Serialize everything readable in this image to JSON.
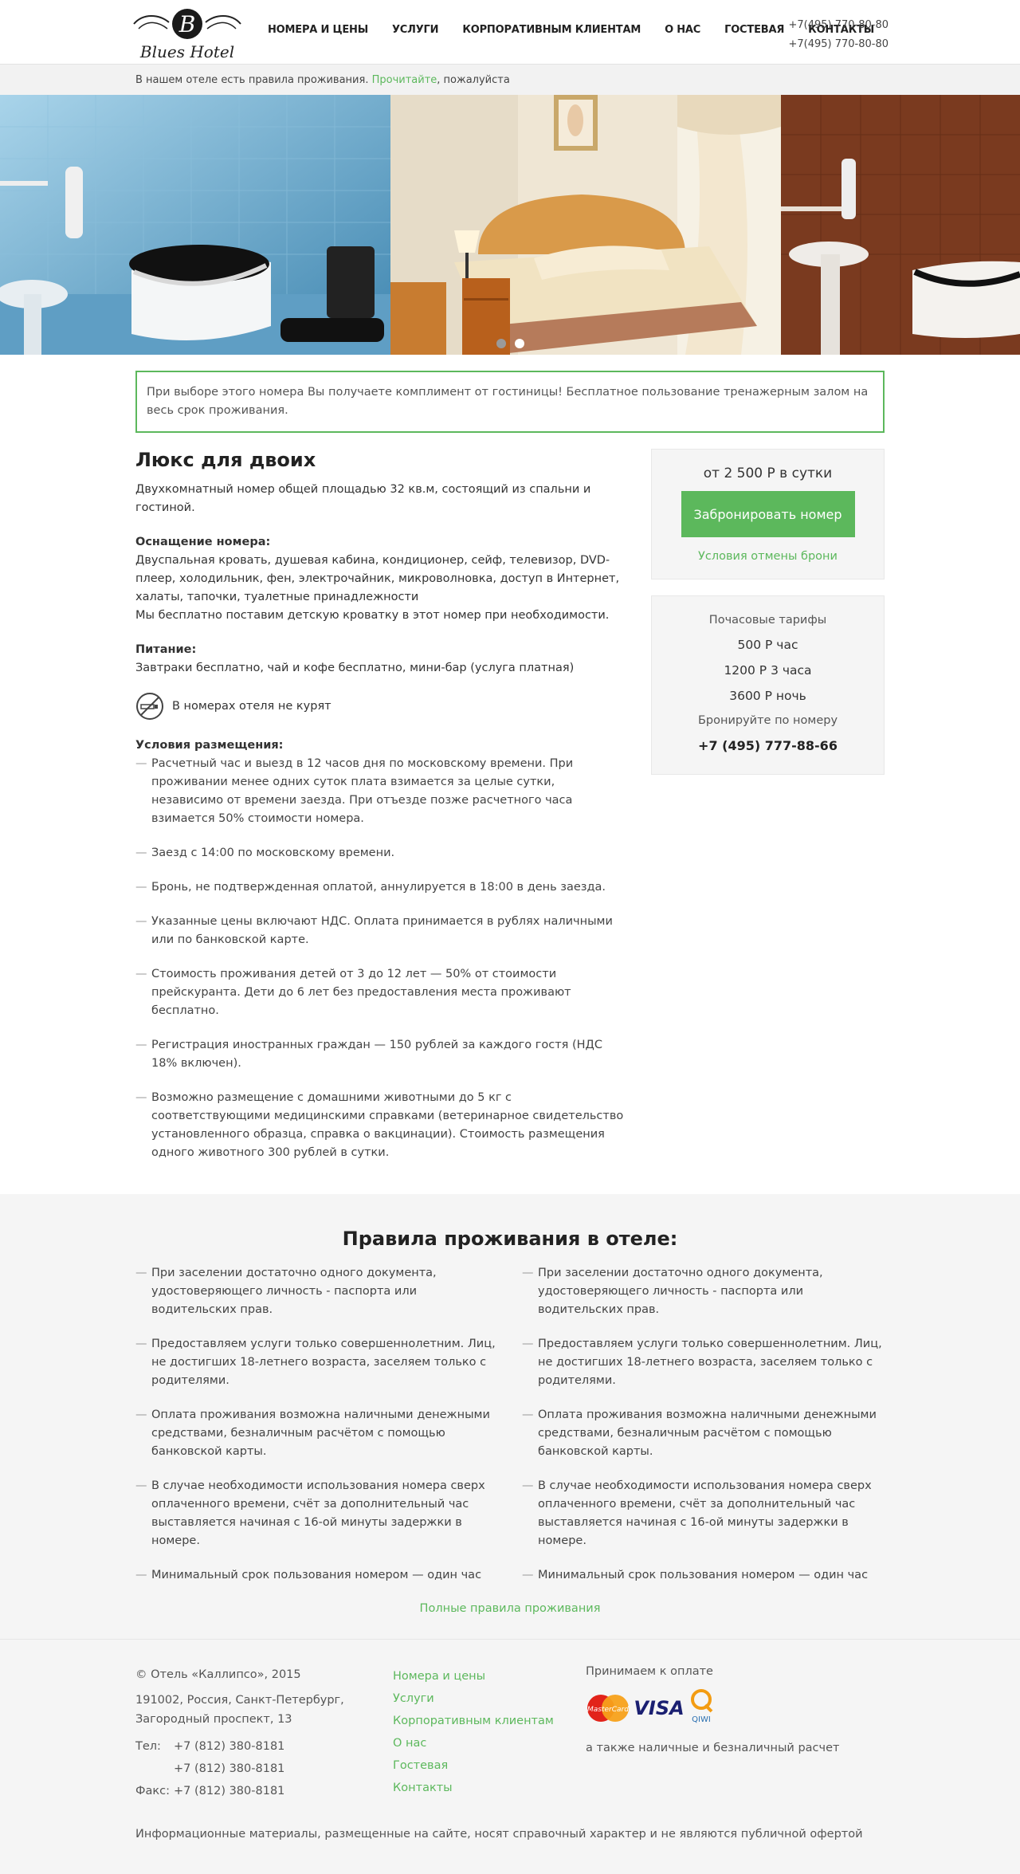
{
  "header": {
    "logo_text": "Blues Hotel",
    "nav": [
      "НОМЕРА И ЦЕНЫ",
      "УСЛУГИ",
      "КОРПОРАТИВНЫМ КЛИЕНТАМ",
      "О НАС",
      "ГОСТЕВАЯ",
      "КОНТАКТЫ"
    ],
    "phone_1": "+7(495) 770-80-80",
    "phone_2": "+7(495) 770-80-80"
  },
  "notice": {
    "text_before": "В нашем отеле есть правила проживания. ",
    "link": "Прочитайте",
    "text_after": ", пожалуйста"
  },
  "slider": {
    "slides": 3,
    "dots": 2,
    "active_dot": 2
  },
  "promo": "При выборе этого номера Вы получаете комплимент от гостиницы! Бесплатное пользование тренажерным залом на весь срок проживания.",
  "room": {
    "title": "Люкс для двоих",
    "lead": "Двухкомнатный номер общей площадью 32 кв.м, состоящий из спальни и гостиной.",
    "equipment_title": "Оснащение номера:",
    "equipment_text": "Двуспальная кровать, душевая кабина, кондиционер, сейф, телевизор, DVD-плеер, холодильник, фен, электрочайник, микроволновка, доступ в Интернет, халаты, тапочки, туалетные принадлежности",
    "equipment_note": "Мы бесплатно поставим детскую кроватку в этот номер при необходимости.",
    "food_title": "Питание:",
    "food_text": "Завтраки бесплатно, чай и кофе бесплатно, мини-бар (услуга платная)",
    "no_smoking": "В номерах отеля не курят",
    "conditions_title": "Условия размещения:",
    "conditions": [
      "Расчетный час и выезд в 12 часов дня по московскому времени. При проживании менее одних суток плата взимается за целые сутки, независимо от времени заезда. При отъезде позже расчетного часа взимается 50% стоимости номера.",
      "Заезд с 14:00 по московскому времени.",
      "Бронь, не подтвержденная оплатой, аннулируется в 18:00 в день заезда.",
      "Указанные цены включают НДС. Оплата принимается в рублях наличными или по банковской карте.",
      "Стоимость проживания детей от 3 до 12 лет — 50% от стоимости прейскуранта. Дети до 6 лет без предоставления места проживают бесплатно.",
      "Регистрация иностранных граждан — 150 рублей за каждого гостя (НДС 18% включен).",
      "Возможно размещение с домашними животными до 5 кг с соответствующими медицинскими справками (ветеринарное свидетельство установленного образца, справка о вакцинации). Стоимость размещения одного животного 300 рублей в сутки."
    ]
  },
  "booking": {
    "price": "от 2 500 Р в сутки",
    "button": "Забронировать номер",
    "cancel_link": "Условия отмены брони"
  },
  "hourly": {
    "title": "Почасовые тарифы",
    "rates": [
      "500 Р час",
      "1200 Р 3 часа",
      "3600 Р ночь"
    ],
    "book_by": "Бронируйте по номеру",
    "phone": "+7 (495) 777-88-66"
  },
  "rules": {
    "title": "Правила проживания в отеле:",
    "left": [
      "При заселении достаточно одного документа, удостоверяющего личность - паспорта или водительских прав.",
      "Предоставляем услуги только совершеннолетним. Лиц, не достигших 18-летнего возраста, заселяем только с родителями.",
      "Оплата проживания возможна наличными денежными средствами, безналичным расчётом с помощью банковской карты.",
      "В случае необходимости использования номера сверх оплаченного времени, счёт за дополнительный час выставляется начиная с 16-ой минуты задержки в номере.",
      "Минимальный срок пользования номером — один час"
    ],
    "right": [
      "При заселении достаточно одного документа, удостоверяющего личность - паспорта или водительских прав.",
      "Предоставляем услуги только совершеннолетним. Лиц, не достигших 18-летнего возраста, заселяем только с родителями.",
      "Оплата проживания возможна наличными денежными средствами, безналичным расчётом с помощью банковской карты.",
      "В случае необходимости использования номера сверх оплаченного времени, счёт за дополнительный час выставляется начиная с 16-ой минуты задержки в номере.",
      "Минимальный срок пользования номером — один час"
    ],
    "full_link": "Полные правила проживания"
  },
  "footer": {
    "copyright": "© Отель «Каллипсо», 2015",
    "address_1": "191002, Россия, Санкт-Петербург,",
    "address_2": "Загородный проспект, 13",
    "tel_label": "Тел:",
    "tel_1": "+7 (812) 380-8181",
    "tel_2": "+7 (812) 380-8181",
    "fax_label": "Факс:",
    "fax": "+7 (812) 380-8181",
    "links": [
      "Номера и цены",
      "Услуги",
      "Корпоративным клиентам",
      "О нас",
      "Гостевая",
      "Контакты"
    ],
    "payment_title": "Принимаем к оплате",
    "payment_logos": {
      "mastercard": "MasterCard",
      "visa": "VISA",
      "qiwi": "QIWI"
    },
    "payment_note": "а также наличные и безналичный расчет",
    "disclaimer": "Информационные материалы, размещенные на сайте, носят справочный характер и не являются публичной офертой"
  },
  "colors": {
    "accent": "#5cb85c",
    "panel": "#f5f5f5"
  }
}
